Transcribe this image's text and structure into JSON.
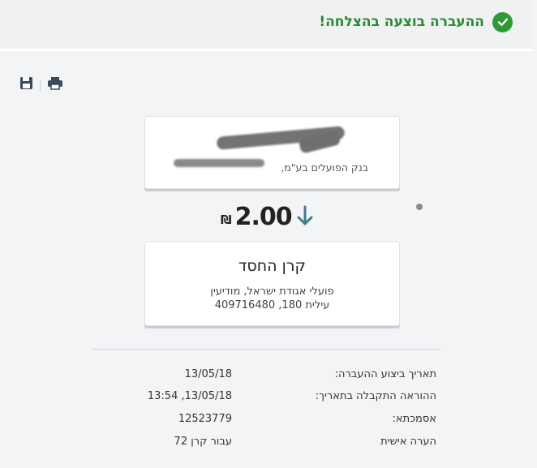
{
  "status": {
    "message": "ההעברה בוצעה בהצלחה!",
    "color": "#2f9a35"
  },
  "toolbar": {
    "save_icon": "save-icon",
    "print_icon": "print-icon"
  },
  "from_account": {
    "bank": "בנק הפועלים בע\"מ,"
  },
  "transfer": {
    "amount": "2.00",
    "currency": "₪",
    "direction_icon": "arrow-down-icon"
  },
  "to_account": {
    "name": "קרן החסד",
    "line1": "פועלי אגודת ישראל, מודיעין",
    "line2": "עילית 180, 409716480"
  },
  "details": [
    {
      "label": "תאריך ביצוע ההעברה:",
      "value": "13/05/18"
    },
    {
      "label": "ההוראה התקבלה בתאריך:",
      "value": "13/05/18, 13:54"
    },
    {
      "label": "אסמכתא:",
      "value": "12523779"
    },
    {
      "label": "הערה אישית",
      "value": "עבור קרן 72"
    }
  ]
}
